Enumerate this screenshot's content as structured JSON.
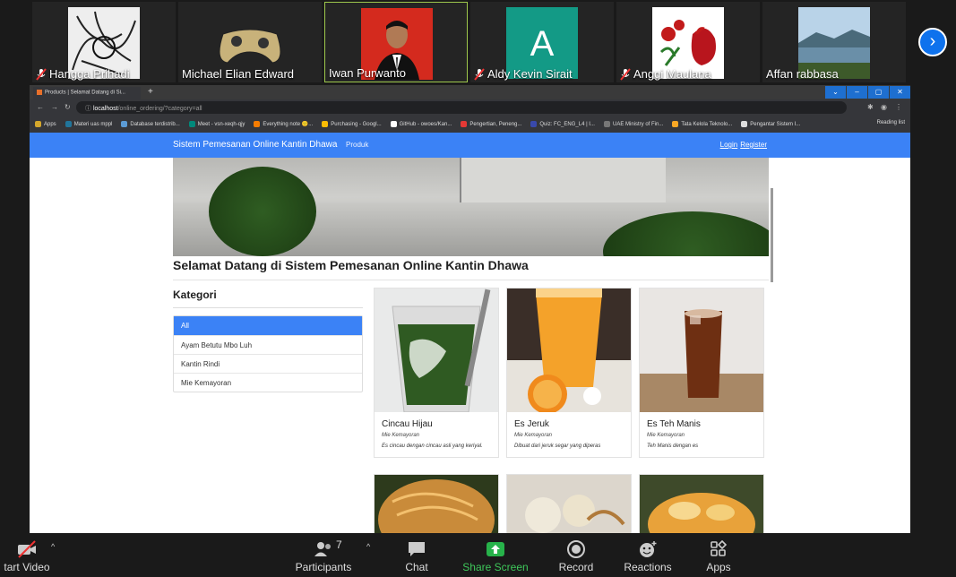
{
  "participants": [
    {
      "name": "Hangga Prihadi",
      "muted": true,
      "thumb": "sketch-art"
    },
    {
      "name": "Michael Elian Edward",
      "muted": false,
      "thumb": "gamepad"
    },
    {
      "name": "Iwan Purwanto",
      "muted": false,
      "thumb": "portrait-red"
    },
    {
      "name": "Aldy Kevin Sirait",
      "muted": true,
      "thumb": "letter-avatar",
      "initial": "A"
    },
    {
      "name": "Anggi Maulana",
      "muted": true,
      "thumb": "rooster-flowers"
    },
    {
      "name": "Affan rabbasa",
      "muted": false,
      "thumb": "lake-landscape"
    }
  ],
  "browser": {
    "tab_title": "Products | Selamat Datang di Si...",
    "url_host": "localhost",
    "url_path": "/online_ordering/?category=all",
    "bookmarks": [
      "Apps",
      "Materi uas mppl",
      "Database terdistrib...",
      "Meet - vsn-xeqh-qjy",
      "Everything note 🙂...",
      "Purchasing - Googl...",
      "GitHub - owoes/Kan...",
      "Pengertian, Peneng...",
      "Quiz: FC_ENG_L4 | I...",
      "UAE Ministry of Fin...",
      "Tata Kelola Teknolo...",
      "Pengantar Sistem I..."
    ],
    "reading_list": "Reading list"
  },
  "site": {
    "brand": "Sistem Pemesanan Online Kantin Dhawa",
    "nav_produk": "Produk",
    "login": "Login",
    "register": "Register",
    "welcome": "Selamat Datang di Sistem Pemesanan Online Kantin Dhawa",
    "kategori_title": "Kategori",
    "categories": [
      "All",
      "Ayam Betutu Mbo Luh",
      "Kantin Rindi",
      "Mie Kemayoran"
    ],
    "products": [
      {
        "name": "Cincau Hijau",
        "category": "Mie Kemayoran",
        "desc": "Es cincau dengan cincau asli yang keriyal."
      },
      {
        "name": "Es Jeruk",
        "category": "Mie Kemayoran",
        "desc": "Dibuat dari jeruk segar yang diperas"
      },
      {
        "name": "Es Teh Manis",
        "category": "Mie Kemayoran",
        "desc": "Teh Manis dengan es"
      }
    ]
  },
  "toolbar": {
    "start_video": "tart Video",
    "participants": "Participants",
    "participants_count": "7",
    "chat": "Chat",
    "share_screen": "Share Screen",
    "record": "Record",
    "reactions": "Reactions",
    "apps": "Apps"
  },
  "colors": {
    "accent": "#3b82f6",
    "zoom_blue": "#0e72ed",
    "share_green": "#3ec75a",
    "active_tile": "#9ec84c"
  }
}
